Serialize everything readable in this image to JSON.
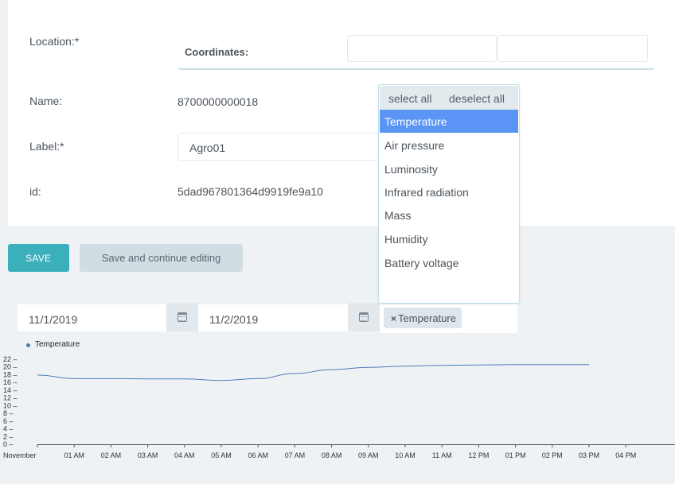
{
  "form": {
    "location_label": "Location:*",
    "coordinates_label": "Coordinates:",
    "name_label": "Name:",
    "name_value": "8700000000018",
    "label_label": "Label:*",
    "label_value": "Agro01",
    "id_label": "id:",
    "id_value": "5dad967801364d9919fe9a10"
  },
  "buttons": {
    "save": "SAVE",
    "save_continue": "Save and continue editing"
  },
  "dropdown": {
    "select_all": "select all",
    "deselect_all": "deselect all",
    "options": [
      "Temperature",
      "Air pressure",
      "Luminosity",
      "Infrared radiation",
      "Mass",
      "Humidity",
      "Battery voltage"
    ],
    "selected": "Temperature"
  },
  "filters": {
    "date_from": "11/1/2019",
    "date_to": "11/2/2019",
    "selected_tag": "Temperature",
    "tag_remove": "×"
  },
  "colors": {
    "accent": "#3bb0bc",
    "selected_option": "#5a95f5",
    "series": "#4f7cba"
  },
  "icons": {
    "date_picker": "calendar-icon",
    "remove_tag": "close-icon"
  },
  "chart_data": {
    "type": "line",
    "legend": "Temperature",
    "legend_placement": "top-left",
    "ylim": [
      0,
      22
    ],
    "y_ticks": [
      "0",
      "2",
      "4",
      "6",
      "8",
      "10",
      "12",
      "14",
      "16",
      "18",
      "20",
      "22"
    ],
    "x_ticks": [
      "November",
      "01 AM",
      "02 AM",
      "03 AM",
      "04 AM",
      "05 AM",
      "06 AM",
      "07 AM",
      "08 AM",
      "09 AM",
      "10 AM",
      "11 AM",
      "12 PM",
      "01 PM",
      "02 PM",
      "03 PM",
      "04 PM"
    ],
    "series": [
      {
        "name": "Temperature",
        "x": [
          0,
          1,
          2,
          3,
          4,
          5,
          6,
          7,
          8,
          9,
          10,
          11,
          12,
          13,
          14,
          15
        ],
        "y": [
          17.9,
          17.0,
          17.0,
          16.9,
          16.9,
          16.5,
          17.0,
          18.3,
          19.3,
          19.9,
          20.2,
          20.4,
          20.5,
          20.6,
          20.6,
          20.6
        ]
      }
    ]
  }
}
